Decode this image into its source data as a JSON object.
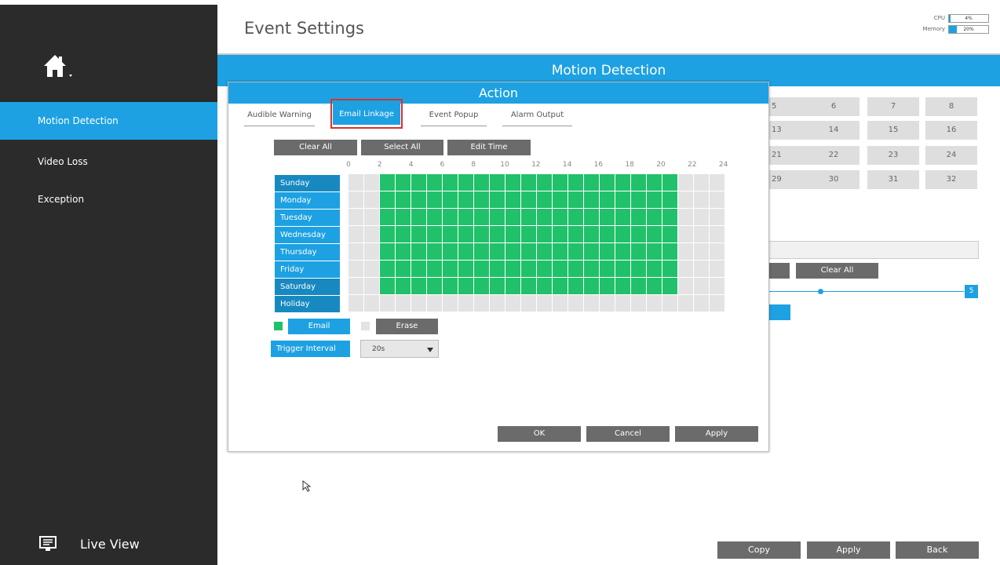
{
  "page": {
    "title": "Event Settings"
  },
  "system": {
    "cpu_label": "CPU",
    "cpu_value": "4%",
    "cpu_percent": 4,
    "memory_label": "Memory",
    "memory_value": "20%",
    "memory_percent": 20
  },
  "sidebar": {
    "items": [
      {
        "label": "Motion Detection",
        "active": true
      },
      {
        "label": "Video Loss",
        "active": false
      },
      {
        "label": "Exception",
        "active": false
      }
    ],
    "live_view": "Live View"
  },
  "main": {
    "header": "Motion Detection",
    "channels": [
      "5",
      "6",
      "7",
      "8",
      "13",
      "14",
      "15",
      "16",
      "21",
      "22",
      "23",
      "24",
      "29",
      "30",
      "31",
      "32"
    ],
    "clear_all": "Clear All",
    "sensitivity_value": "5",
    "buttons": {
      "copy": "Copy",
      "apply": "Apply",
      "back": "Back"
    }
  },
  "dialog": {
    "title": "Action",
    "tabs": [
      {
        "label": "Audible Warning",
        "active": false
      },
      {
        "label": "Email Linkage",
        "active": true
      },
      {
        "label": "Event Popup",
        "active": false
      },
      {
        "label": "Alarm Output",
        "active": false
      }
    ],
    "toolbar": {
      "clear_all": "Clear All",
      "select_all": "Select All",
      "edit_time": "Edit Time"
    },
    "hours": [
      "0",
      "2",
      "4",
      "6",
      "8",
      "10",
      "12",
      "14",
      "16",
      "18",
      "20",
      "22",
      "24"
    ],
    "days": [
      "Sunday",
      "Monday",
      "Tuesday",
      "Wednesday",
      "Thursday",
      "Friday",
      "Saturday",
      "Holiday"
    ],
    "schedule": {
      "Sunday": [
        2,
        21
      ],
      "Monday": [
        2,
        21
      ],
      "Tuesday": [
        2,
        21
      ],
      "Wednesday": [
        2,
        21
      ],
      "Thursday": [
        2,
        21
      ],
      "Friday": [
        2,
        21
      ],
      "Saturday": [
        2,
        21
      ],
      "Holiday": null
    },
    "legend": {
      "email": "Email",
      "erase": "Erase",
      "email_color": "#20c16a",
      "erase_color": "#e3e3e3"
    },
    "trigger_interval": {
      "label": "Trigger Interval",
      "value": "20s"
    },
    "buttons": {
      "ok": "OK",
      "cancel": "Cancel",
      "apply": "Apply"
    }
  }
}
